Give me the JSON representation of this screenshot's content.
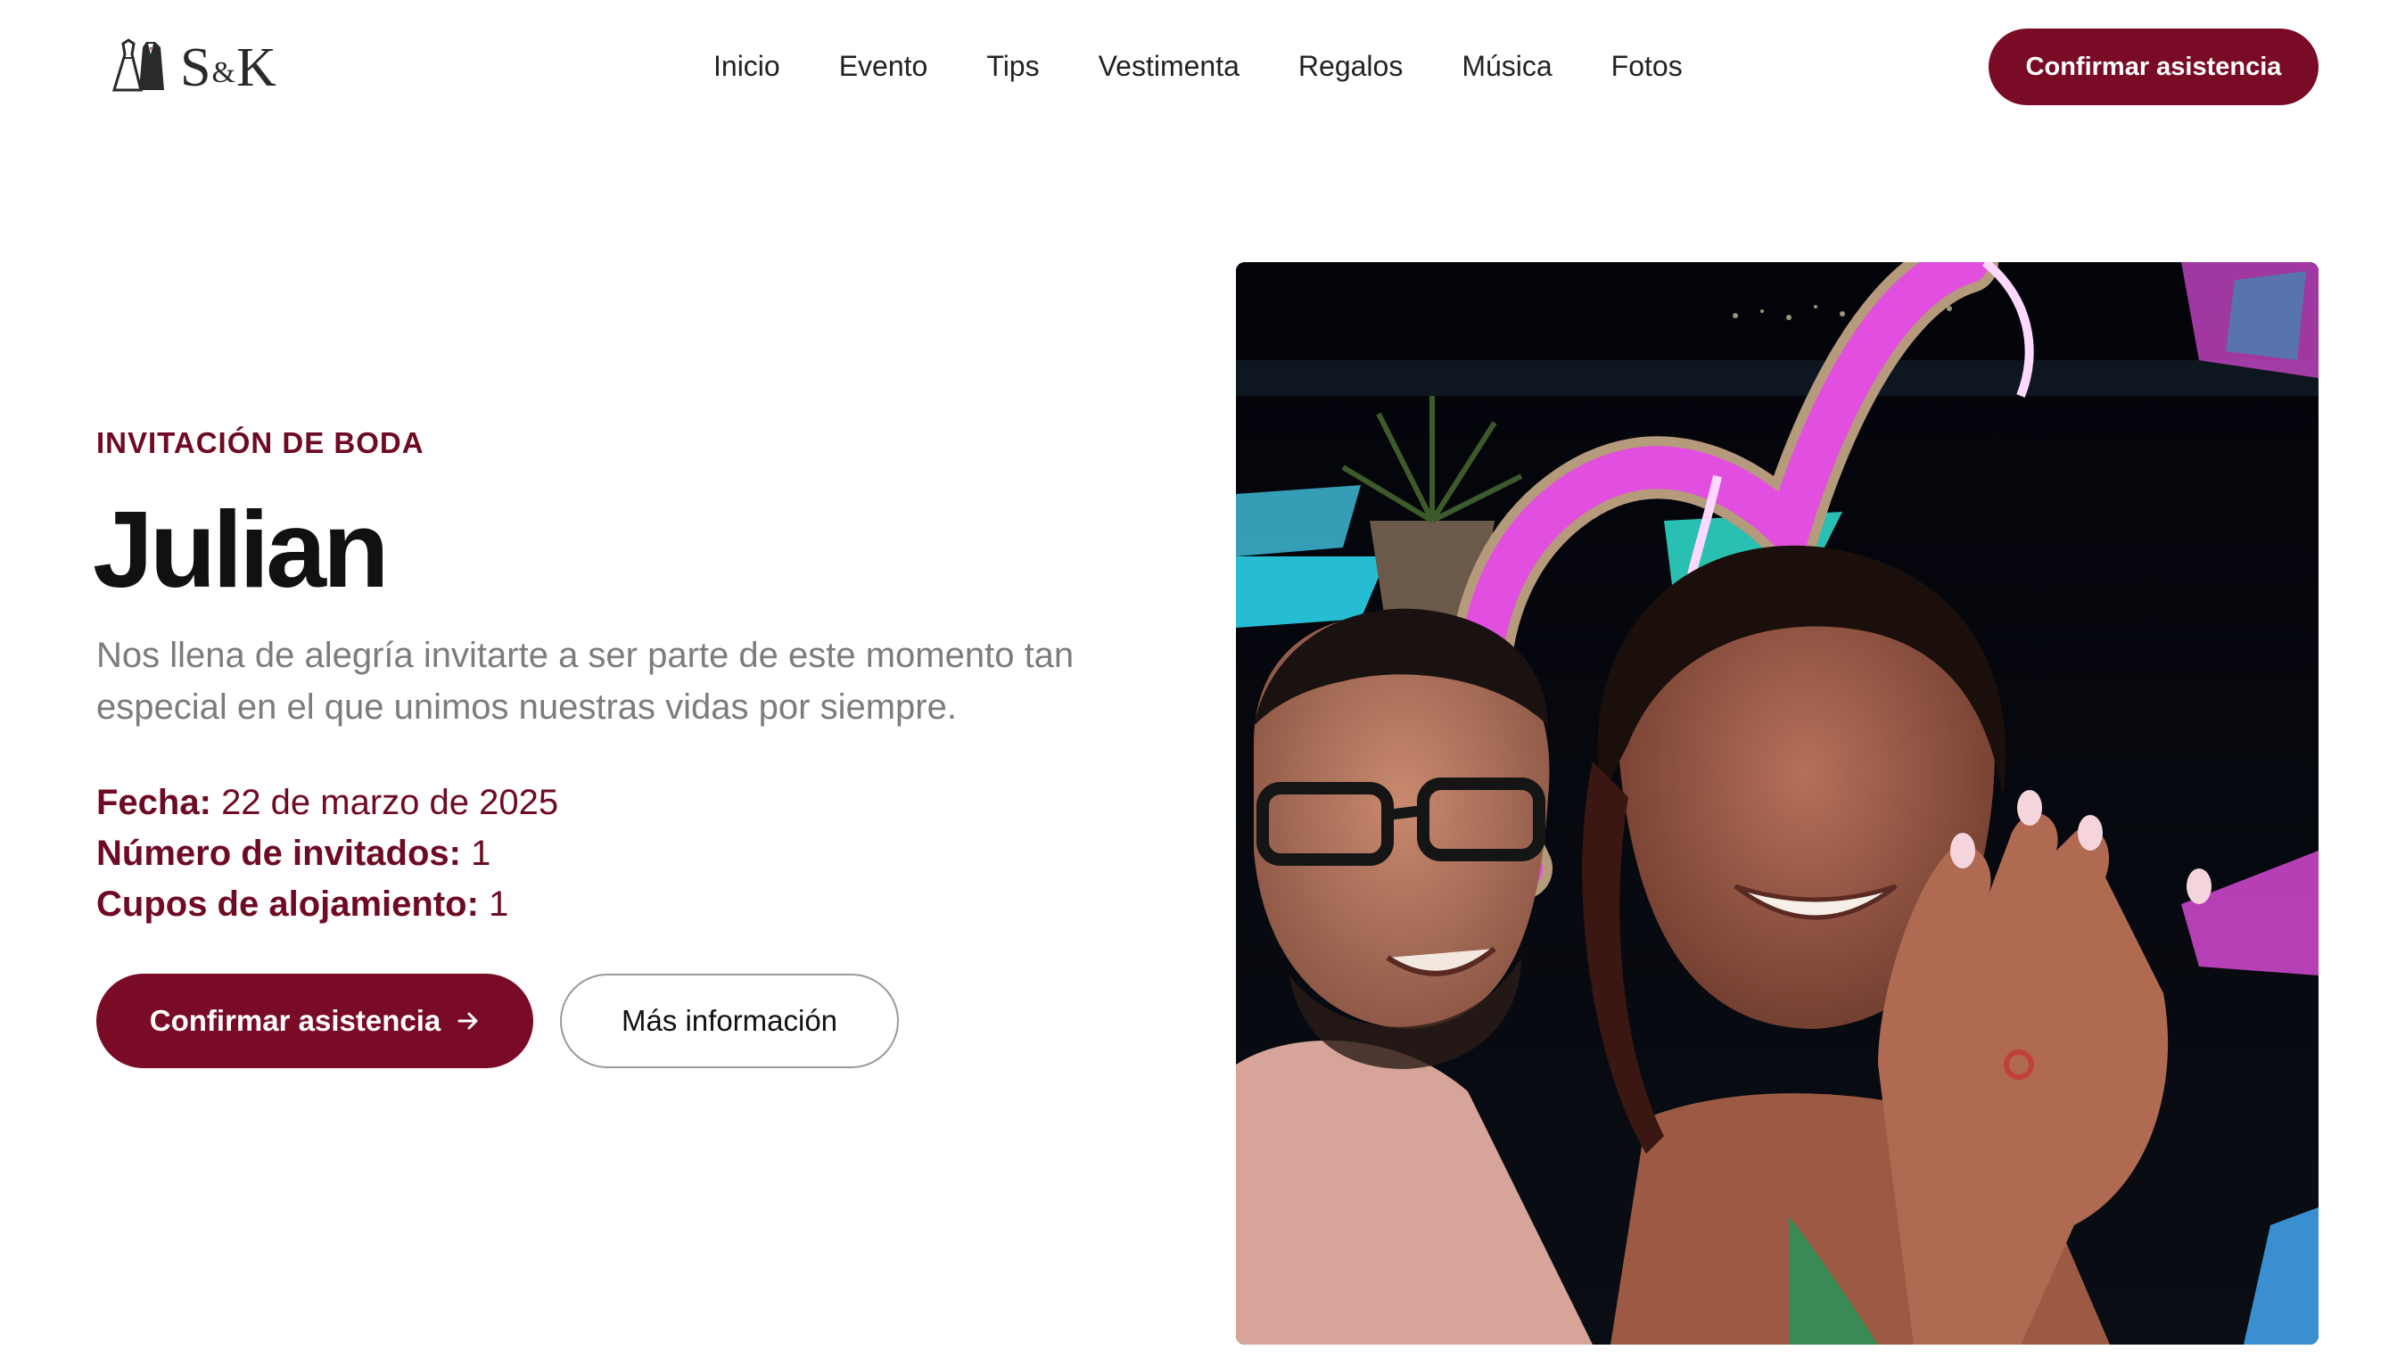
{
  "header": {
    "logo_text": "S&K",
    "nav": [
      "Inicio",
      "Evento",
      "Tips",
      "Vestimenta",
      "Regalos",
      "Música",
      "Fotos"
    ],
    "cta_label": "Confirmar asistencia"
  },
  "hero": {
    "eyebrow": "INVITACIÓN DE BODA",
    "title": "Julian",
    "description": "Nos llena de alegría invitarte a ser parte de este momento tan especial en el que unimos nuestras vidas por siempre.",
    "details": [
      {
        "label": "Fecha:",
        "value": "22 de marzo de 2025"
      },
      {
        "label": "Número de invitados:",
        "value": "1"
      },
      {
        "label": "Cupos de alojamiento:",
        "value": "1"
      }
    ],
    "primary_button": "Confirmar asistencia",
    "secondary_button": "Más información"
  },
  "colors": {
    "accent": "#7a0b26",
    "eyebrow": "#6e0a22",
    "muted_text": "#7c7c7c"
  },
  "icons": {
    "logo": "wedding-couple-icon",
    "button_arrow": "arrow-right-icon"
  }
}
